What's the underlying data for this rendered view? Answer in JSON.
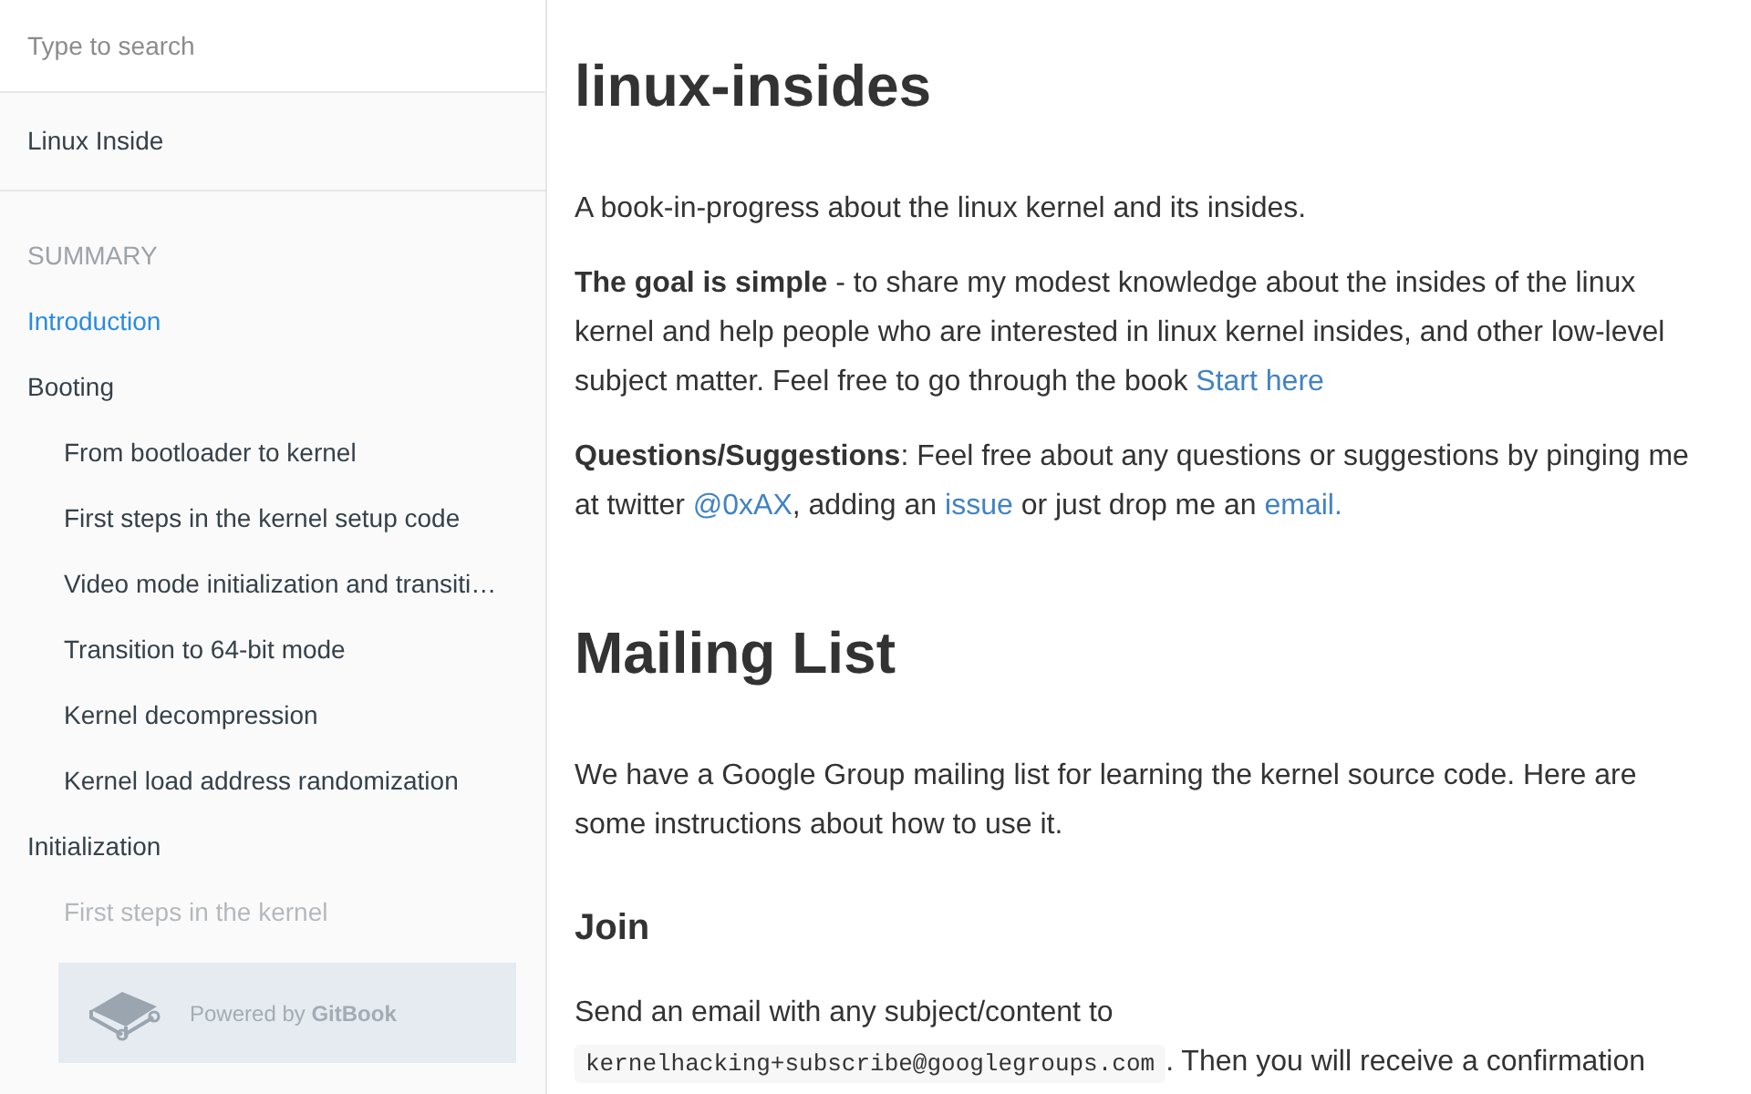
{
  "sidebar": {
    "search": {
      "placeholder": "Type to search"
    },
    "book_title": "Linux Inside",
    "summary_heading": "SUMMARY",
    "items": [
      {
        "label": "Introduction",
        "selected": true,
        "dimmed": false
      },
      {
        "label": "Booting",
        "selected": false,
        "dimmed": false,
        "children": [
          {
            "label": "From bootloader to kernel",
            "selected": false,
            "dimmed": false
          },
          {
            "label": "First steps in the kernel setup code",
            "selected": false,
            "dimmed": false
          },
          {
            "label": "Video mode initialization and transiti…",
            "selected": false,
            "dimmed": false
          },
          {
            "label": "Transition to 64-bit mode",
            "selected": false,
            "dimmed": false
          },
          {
            "label": "Kernel decompression",
            "selected": false,
            "dimmed": false
          },
          {
            "label": "Kernel load address randomization",
            "selected": false,
            "dimmed": false
          }
        ]
      },
      {
        "label": "Initialization",
        "selected": false,
        "dimmed": false,
        "children": [
          {
            "label": "First steps in the kernel",
            "selected": false,
            "dimmed": true
          }
        ]
      }
    ],
    "footer": {
      "text": "Powered by **GitBook**"
    }
  },
  "content": {
    "blocks": [
      {
        "kind": "h1",
        "text": "linux-insides"
      },
      {
        "kind": "p",
        "segments": [
          {
            "kind": "text",
            "text": "A book-in-progress about the linux kernel and its insides."
          }
        ]
      },
      {
        "kind": "p",
        "segments": [
          {
            "kind": "text",
            "text": "**The goal is simple** - to share my modest knowledge about the insides of the linux kernel and help people who are interested in linux kernel insides, and other low-level subject matter. Feel free to go through the book "
          },
          {
            "kind": "link",
            "text": "Start here"
          }
        ]
      },
      {
        "kind": "p",
        "segments": [
          {
            "kind": "text",
            "text": "**Questions/Suggestions**: Feel free about any questions or suggestions by pinging me at twitter "
          },
          {
            "kind": "link",
            "text": "@0xAX"
          },
          {
            "kind": "text",
            "text": ", adding an "
          },
          {
            "kind": "link",
            "text": "issue"
          },
          {
            "kind": "text",
            "text": " or just drop me an "
          },
          {
            "kind": "link",
            "text": "email."
          }
        ]
      },
      {
        "kind": "h1",
        "text": "Mailing List"
      },
      {
        "kind": "p",
        "segments": [
          {
            "kind": "text",
            "text": "We have a Google Group mailing list for learning the kernel source code. Here are some instructions about how to use it."
          }
        ]
      },
      {
        "kind": "h3",
        "text": "Join"
      },
      {
        "kind": "p",
        "segments": [
          {
            "kind": "text",
            "text": "Send an email with any subject/content to "
          },
          {
            "kind": "code",
            "text": "kernelhacking+subscribe@googlegroups.com"
          },
          {
            "kind": "text",
            "text": ". Then you will receive a confirmation"
          }
        ]
      }
    ]
  }
}
